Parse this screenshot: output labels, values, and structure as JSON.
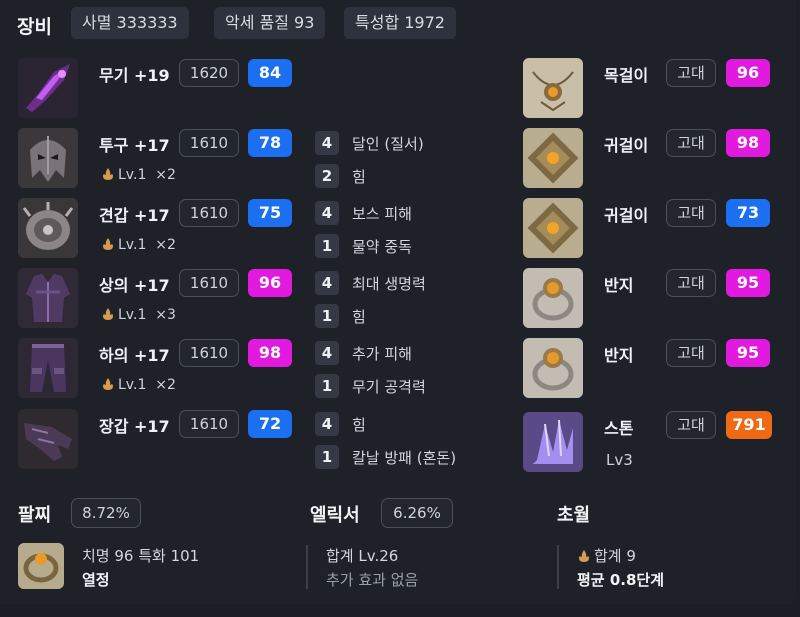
{
  "header": {
    "title": "장비",
    "chips": [
      "사멸 333333",
      "악세 품질 93",
      "특성합 1972"
    ]
  },
  "equipment": [
    {
      "name": "무기 +19",
      "item_level": "1620",
      "quality": "84",
      "quality_color": "#1d6ff2",
      "icon": "weapon-icon"
    },
    {
      "name": "투구 +17",
      "item_level": "1610",
      "quality": "78",
      "quality_color": "#1d6ff2",
      "icon": "helmet-icon",
      "bonus_level": "Lv.1",
      "bonus_count": "×2"
    },
    {
      "name": "견갑 +17",
      "item_level": "1610",
      "quality": "75",
      "quality_color": "#1d6ff2",
      "icon": "shoulder-icon",
      "bonus_level": "Lv.1",
      "bonus_count": "×2"
    },
    {
      "name": "상의 +17",
      "item_level": "1610",
      "quality": "96",
      "quality_color": "#e21ae0",
      "icon": "chest-icon",
      "bonus_level": "Lv.1",
      "bonus_count": "×3"
    },
    {
      "name": "하의 +17",
      "item_level": "1610",
      "quality": "98",
      "quality_color": "#e21ae0",
      "icon": "pants-icon",
      "bonus_level": "Lv.1",
      "bonus_count": "×2"
    },
    {
      "name": "장갑 +17",
      "item_level": "1610",
      "quality": "72",
      "quality_color": "#1d6ff2",
      "icon": "gloves-icon"
    }
  ],
  "engravings": [
    {
      "level": "4",
      "name": "달인 (질서)"
    },
    {
      "level": "2",
      "name": "힘"
    },
    {
      "level": "4",
      "name": "보스 피해"
    },
    {
      "level": "1",
      "name": "물약 중독"
    },
    {
      "level": "4",
      "name": "최대 생명력"
    },
    {
      "level": "1",
      "name": "힘"
    },
    {
      "level": "4",
      "name": "추가 피해"
    },
    {
      "level": "1",
      "name": "무기 공격력"
    },
    {
      "level": "4",
      "name": "힘"
    },
    {
      "level": "1",
      "name": "칼날 방패 (혼돈)"
    }
  ],
  "accessories": [
    {
      "name": "목걸이",
      "grade": "고대",
      "quality": "96",
      "quality_color": "#e21ae0",
      "icon": "necklace-icon"
    },
    {
      "name": "귀걸이",
      "grade": "고대",
      "quality": "98",
      "quality_color": "#e21ae0",
      "icon": "earring-icon"
    },
    {
      "name": "귀걸이",
      "grade": "고대",
      "quality": "73",
      "quality_color": "#1d6ff2",
      "icon": "earring-icon"
    },
    {
      "name": "반지",
      "grade": "고대",
      "quality": "95",
      "quality_color": "#e21ae0",
      "icon": "ring-icon"
    },
    {
      "name": "반지",
      "grade": "고대",
      "quality": "95",
      "quality_color": "#e21ae0",
      "icon": "ring-icon"
    },
    {
      "name": "스톤",
      "grade": "고대",
      "quality": "791",
      "quality_color": "#ee6a14",
      "icon": "stone-icon",
      "sub": "Lv3"
    }
  ],
  "bracelet": {
    "title": "팔찌",
    "value": "8.72%",
    "stats": "치명 96  특화 101",
    "effect": "열정",
    "icon": "bracelet-icon"
  },
  "elixir": {
    "title": "엘릭서",
    "value": "6.26%",
    "total": "합계 Lv.26",
    "effect": "추가 효과 없음"
  },
  "transcend": {
    "title": "초월",
    "total": "합계 9",
    "avg": "평균 0.8단계",
    "icon": "flame-icon"
  }
}
